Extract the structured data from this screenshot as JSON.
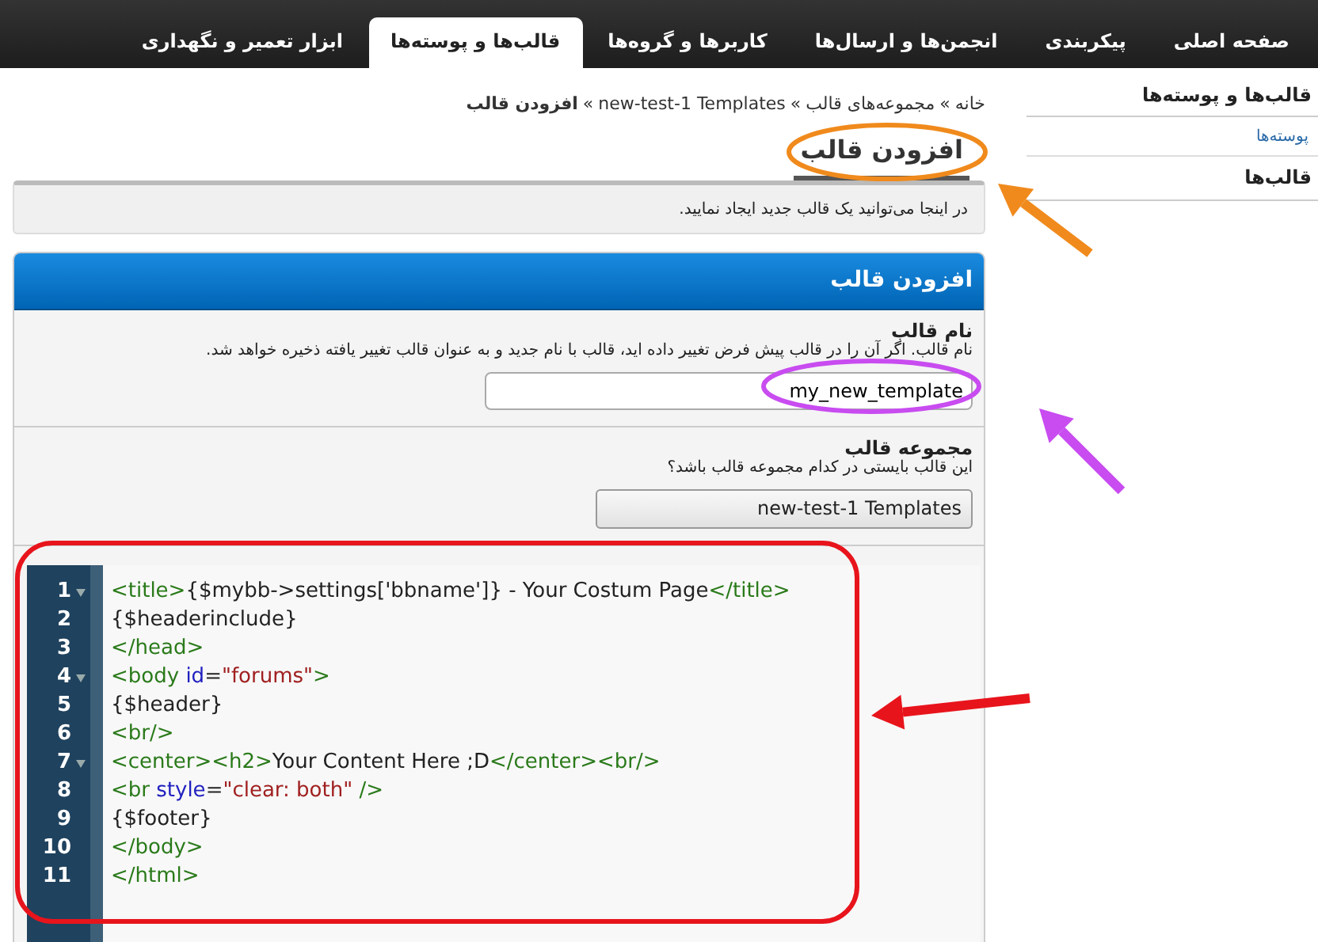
{
  "top_tabs": [
    {
      "label": "صفحه اصلی",
      "selected": false
    },
    {
      "label": "پیکربندی",
      "selected": false
    },
    {
      "label": "انجمن‌ها و ارسال‌ها",
      "selected": false
    },
    {
      "label": "کاربرها و گروه‌ها",
      "selected": false
    },
    {
      "label": "قالب‌ها و پوسته‌ها",
      "selected": true
    },
    {
      "label": "ابزار تعمیر و نگهداری",
      "selected": false
    }
  ],
  "sidebar": {
    "title": "قالب‌ها و پوسته‌ها",
    "items": [
      {
        "label": "پوسته‌ها",
        "kind": "link"
      },
      {
        "label": "قالب‌ها",
        "kind": "heading"
      }
    ]
  },
  "breadcrumb": [
    {
      "label": "خانه",
      "current": false
    },
    {
      "label": "مجموعه‌های قالب",
      "current": false
    },
    {
      "label": "new-test-1 Templates",
      "current": false
    },
    {
      "label": "افزودن قالب",
      "current": true
    }
  ],
  "breadcrumb_separator": "»",
  "page_title": "افزودن قالب",
  "info": "در اینجا می‌توانید یک قالب جدید ایجاد نمایید.",
  "panel": {
    "title": "افزودن قالب",
    "fields": [
      {
        "kind": "text",
        "label": "نام قالب",
        "description": "نام قالب. اگر آن را در قالب پیش فرض تغییر داده اید، قالب با نام جدید و به عنوان قالب تغییر یافته ذخیره خواهد شد.",
        "value": "my_new_template"
      },
      {
        "kind": "select",
        "label": "مجموعه قالب",
        "description": "این قالب بایستی در کدام مجموعه قالب باشد؟",
        "value": "new-test-1 Templates"
      }
    ],
    "code": [
      {
        "number": "1",
        "foldable": true,
        "text": "<title>{$mybb->settings['bbname']} - Your Costum Page</title>"
      },
      {
        "number": "2",
        "foldable": false,
        "text": "{$headerinclude}"
      },
      {
        "number": "3",
        "foldable": false,
        "text": "</head>"
      },
      {
        "number": "4",
        "foldable": true,
        "text": "<body id=\"forums\">"
      },
      {
        "number": "5",
        "foldable": false,
        "text": "{$header}"
      },
      {
        "number": "6",
        "foldable": false,
        "text": "<br/>"
      },
      {
        "number": "7",
        "foldable": true,
        "text": "<center><h2>Your Content Here ;D</center><br/>"
      },
      {
        "number": "8",
        "foldable": false,
        "text": "<br style=\"clear: both\" />"
      },
      {
        "number": "9",
        "foldable": false,
        "text": "{$footer}"
      },
      {
        "number": "10",
        "foldable": false,
        "text": "</body>"
      },
      {
        "number": "11",
        "foldable": false,
        "text": "</html>"
      }
    ]
  },
  "annotations": [
    {
      "kind": "ellipse",
      "color": "#f08a1c"
    },
    {
      "kind": "ellipse",
      "color": "#c84cf0"
    },
    {
      "kind": "rect",
      "color": "#e8141c"
    }
  ]
}
